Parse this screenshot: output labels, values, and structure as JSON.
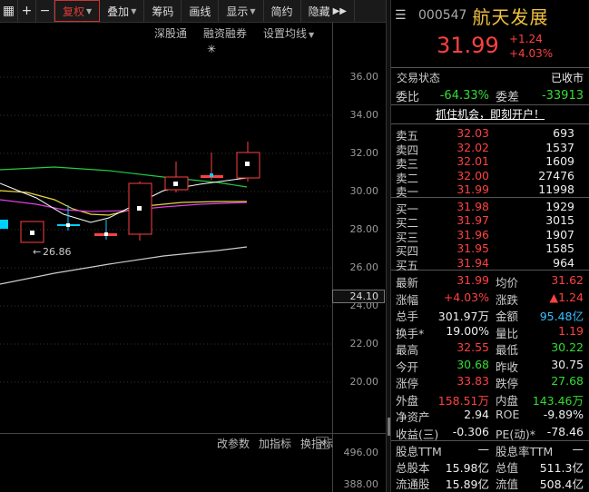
{
  "toolbar": {
    "items": [
      "复权",
      "叠加",
      "筹码",
      "画线",
      "显示",
      "简约",
      "隐藏"
    ]
  },
  "subbar": {
    "items": [
      "深股通",
      "融资融券",
      "设置均线"
    ]
  },
  "star": "✳",
  "price_axis": [
    "36.00",
    "34.00",
    "32.00",
    "30.00",
    "28.00",
    "26.00",
    "24.00",
    "22.00",
    "20.00"
  ],
  "price_box": "24.10",
  "low_marker": "26.86",
  "indicator_bar": [
    "改参数",
    "加指标",
    "换指标"
  ],
  "volume_axis": [
    "496.00",
    "388.00"
  ],
  "quote": {
    "code": "000547",
    "name": "航天发展",
    "last": "31.99",
    "change": "+1.24",
    "change_pct": "+4.03%",
    "state_label": "交易状态",
    "state_value": "已收市",
    "ratio_label": "委比",
    "ratio_value": "-64.33%",
    "diff_label": "委差",
    "diff_value": "-33913",
    "promo": "抓住机会，即刻开户！",
    "asks": [
      {
        "label": "卖五",
        "price": "32.03",
        "vol": "693"
      },
      {
        "label": "卖四",
        "price": "32.02",
        "vol": "1537"
      },
      {
        "label": "卖三",
        "price": "32.01",
        "vol": "1609"
      },
      {
        "label": "卖二",
        "price": "32.00",
        "vol": "27476"
      },
      {
        "label": "卖一",
        "price": "31.99",
        "vol": "11998"
      }
    ],
    "bids": [
      {
        "label": "买一",
        "price": "31.98",
        "vol": "1929"
      },
      {
        "label": "买二",
        "price": "31.97",
        "vol": "3015"
      },
      {
        "label": "买三",
        "price": "31.96",
        "vol": "1907"
      },
      {
        "label": "买四",
        "price": "31.95",
        "vol": "1585"
      },
      {
        "label": "买五",
        "price": "31.94",
        "vol": "964"
      }
    ],
    "stats": [
      {
        "l1": "最新",
        "v1": "31.99",
        "c1": "red",
        "l2": "均价",
        "v2": "31.62",
        "c2": "red"
      },
      {
        "l1": "涨幅",
        "v1": "+4.03%",
        "c1": "red",
        "l2": "涨跌",
        "v2": "▲1.24",
        "c2": "red"
      },
      {
        "l1": "总手",
        "v1": "301.97万",
        "c1": "white",
        "l2": "金额",
        "v2": "95.48亿",
        "c2": "cyan"
      },
      {
        "l1": "换手*",
        "v1": "19.00%",
        "c1": "white",
        "l2": "量比",
        "v2": "1.19",
        "c2": "red"
      },
      {
        "l1": "最高",
        "v1": "32.55",
        "c1": "red",
        "l2": "最低",
        "v2": "30.22",
        "c2": "green"
      },
      {
        "l1": "今开",
        "v1": "30.68",
        "c1": "green",
        "l2": "昨收",
        "v2": "30.75",
        "c2": "white"
      },
      {
        "l1": "涨停",
        "v1": "33.83",
        "c1": "red",
        "l2": "跌停",
        "v2": "27.68",
        "c2": "green"
      },
      {
        "l1": "外盘",
        "v1": "158.51万",
        "c1": "red",
        "l2": "内盘",
        "v2": "143.46万",
        "c2": "green"
      },
      {
        "l1": "净资产",
        "v1": "2.94",
        "c1": "white",
        "l2": "ROE",
        "v2": "-9.89%",
        "c2": "white"
      },
      {
        "l1": "收益(三)",
        "v1": "-0.306",
        "c1": "white",
        "l2": "PE(动)*",
        "v2": "-78.46",
        "c2": "white"
      },
      {
        "l1": "股息TTM",
        "v1": "—",
        "c1": "white",
        "l2": "股息率TTM",
        "v2": "—",
        "c2": "white"
      },
      {
        "l1": "总股本",
        "v1": "15.98亿",
        "c1": "white",
        "l2": "总值",
        "v2": "511.3亿",
        "c2": "white"
      },
      {
        "l1": "流通股",
        "v1": "15.89亿",
        "c1": "white",
        "l2": "流值",
        "v2": "508.4亿",
        "c2": "white"
      }
    ]
  },
  "colors": {
    "up": "#ff4040",
    "down": "#33dd33",
    "accent": "#f0c040"
  }
}
